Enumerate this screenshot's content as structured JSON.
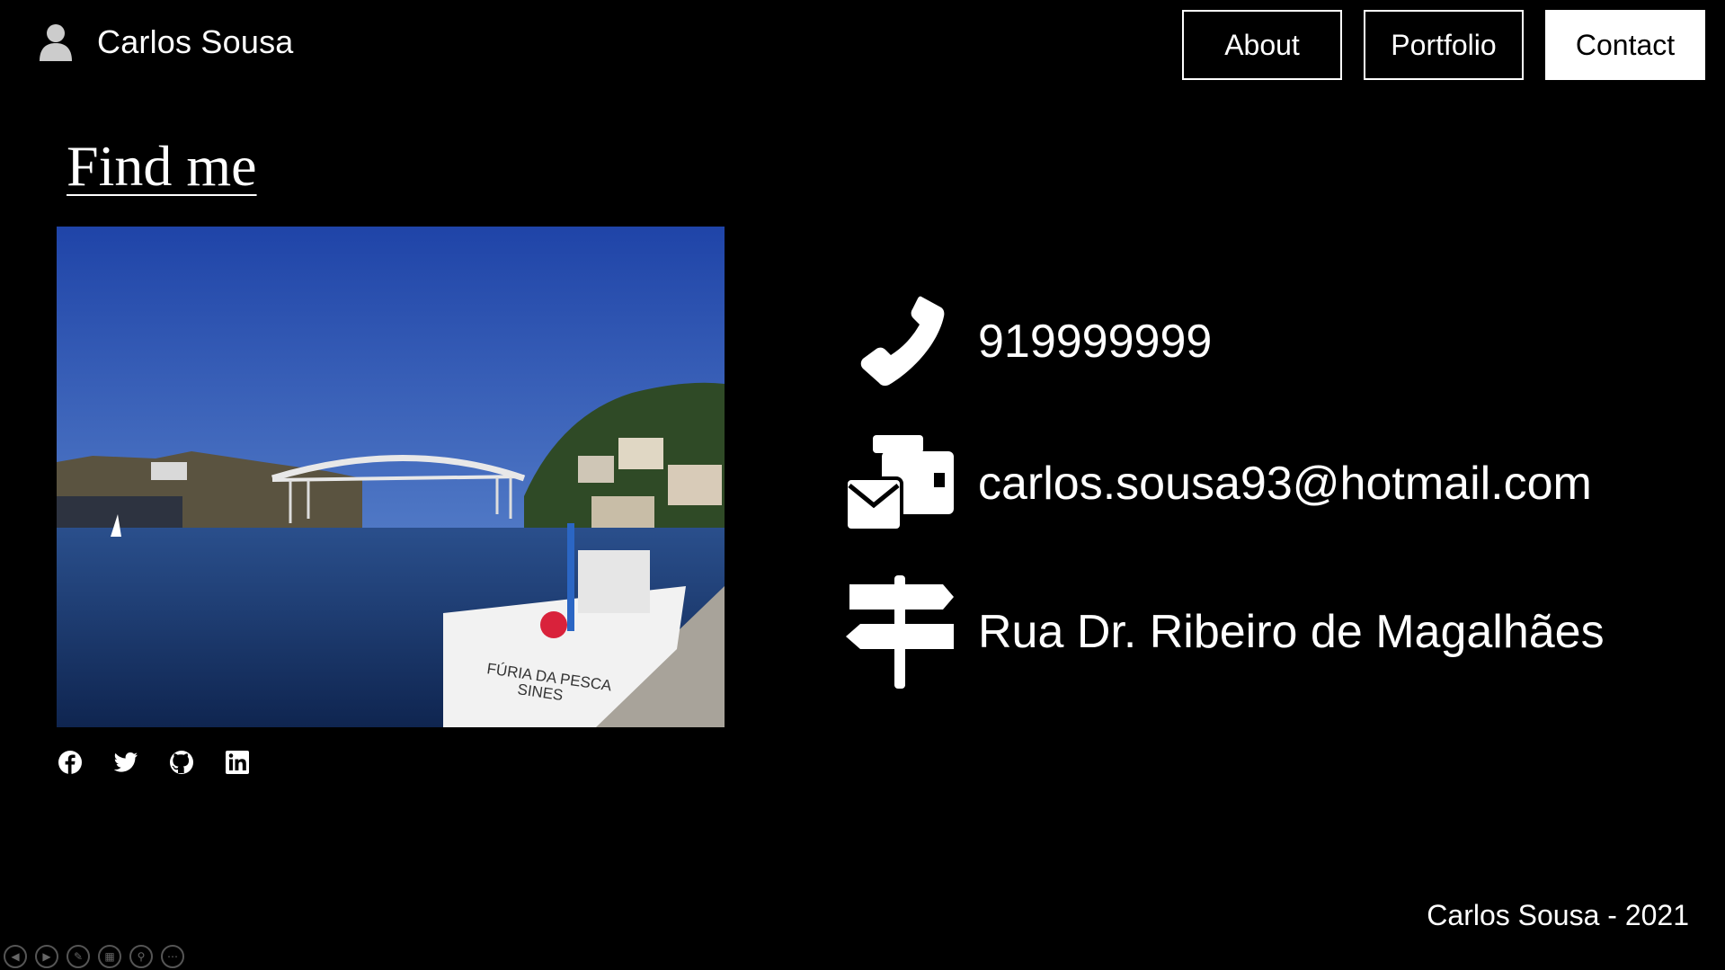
{
  "header": {
    "brand_name": "Carlos Sousa",
    "brand_icon": "user-icon"
  },
  "nav": {
    "items": [
      {
        "label": "About",
        "active": false
      },
      {
        "label": "Portfolio",
        "active": false
      },
      {
        "label": "Contact",
        "active": true
      }
    ]
  },
  "main": {
    "title": "Find me",
    "photo": {
      "boat_text_line1": "FÚRIA DA PESCA",
      "boat_text_line2": "SINES"
    },
    "socials": [
      "facebook-icon",
      "twitter-icon",
      "github-icon",
      "linkedin-icon"
    ],
    "contact": {
      "phone": "919999999",
      "email": "carlos.sousa93@hotmail.com",
      "address": "Rua Dr. Ribeiro de Magalhães"
    }
  },
  "footer": {
    "text": "Carlos Sousa - 2021"
  },
  "colors": {
    "background": "#000000",
    "foreground": "#ffffff",
    "sky": "#2b56b8",
    "water": "#1f3f7a"
  }
}
